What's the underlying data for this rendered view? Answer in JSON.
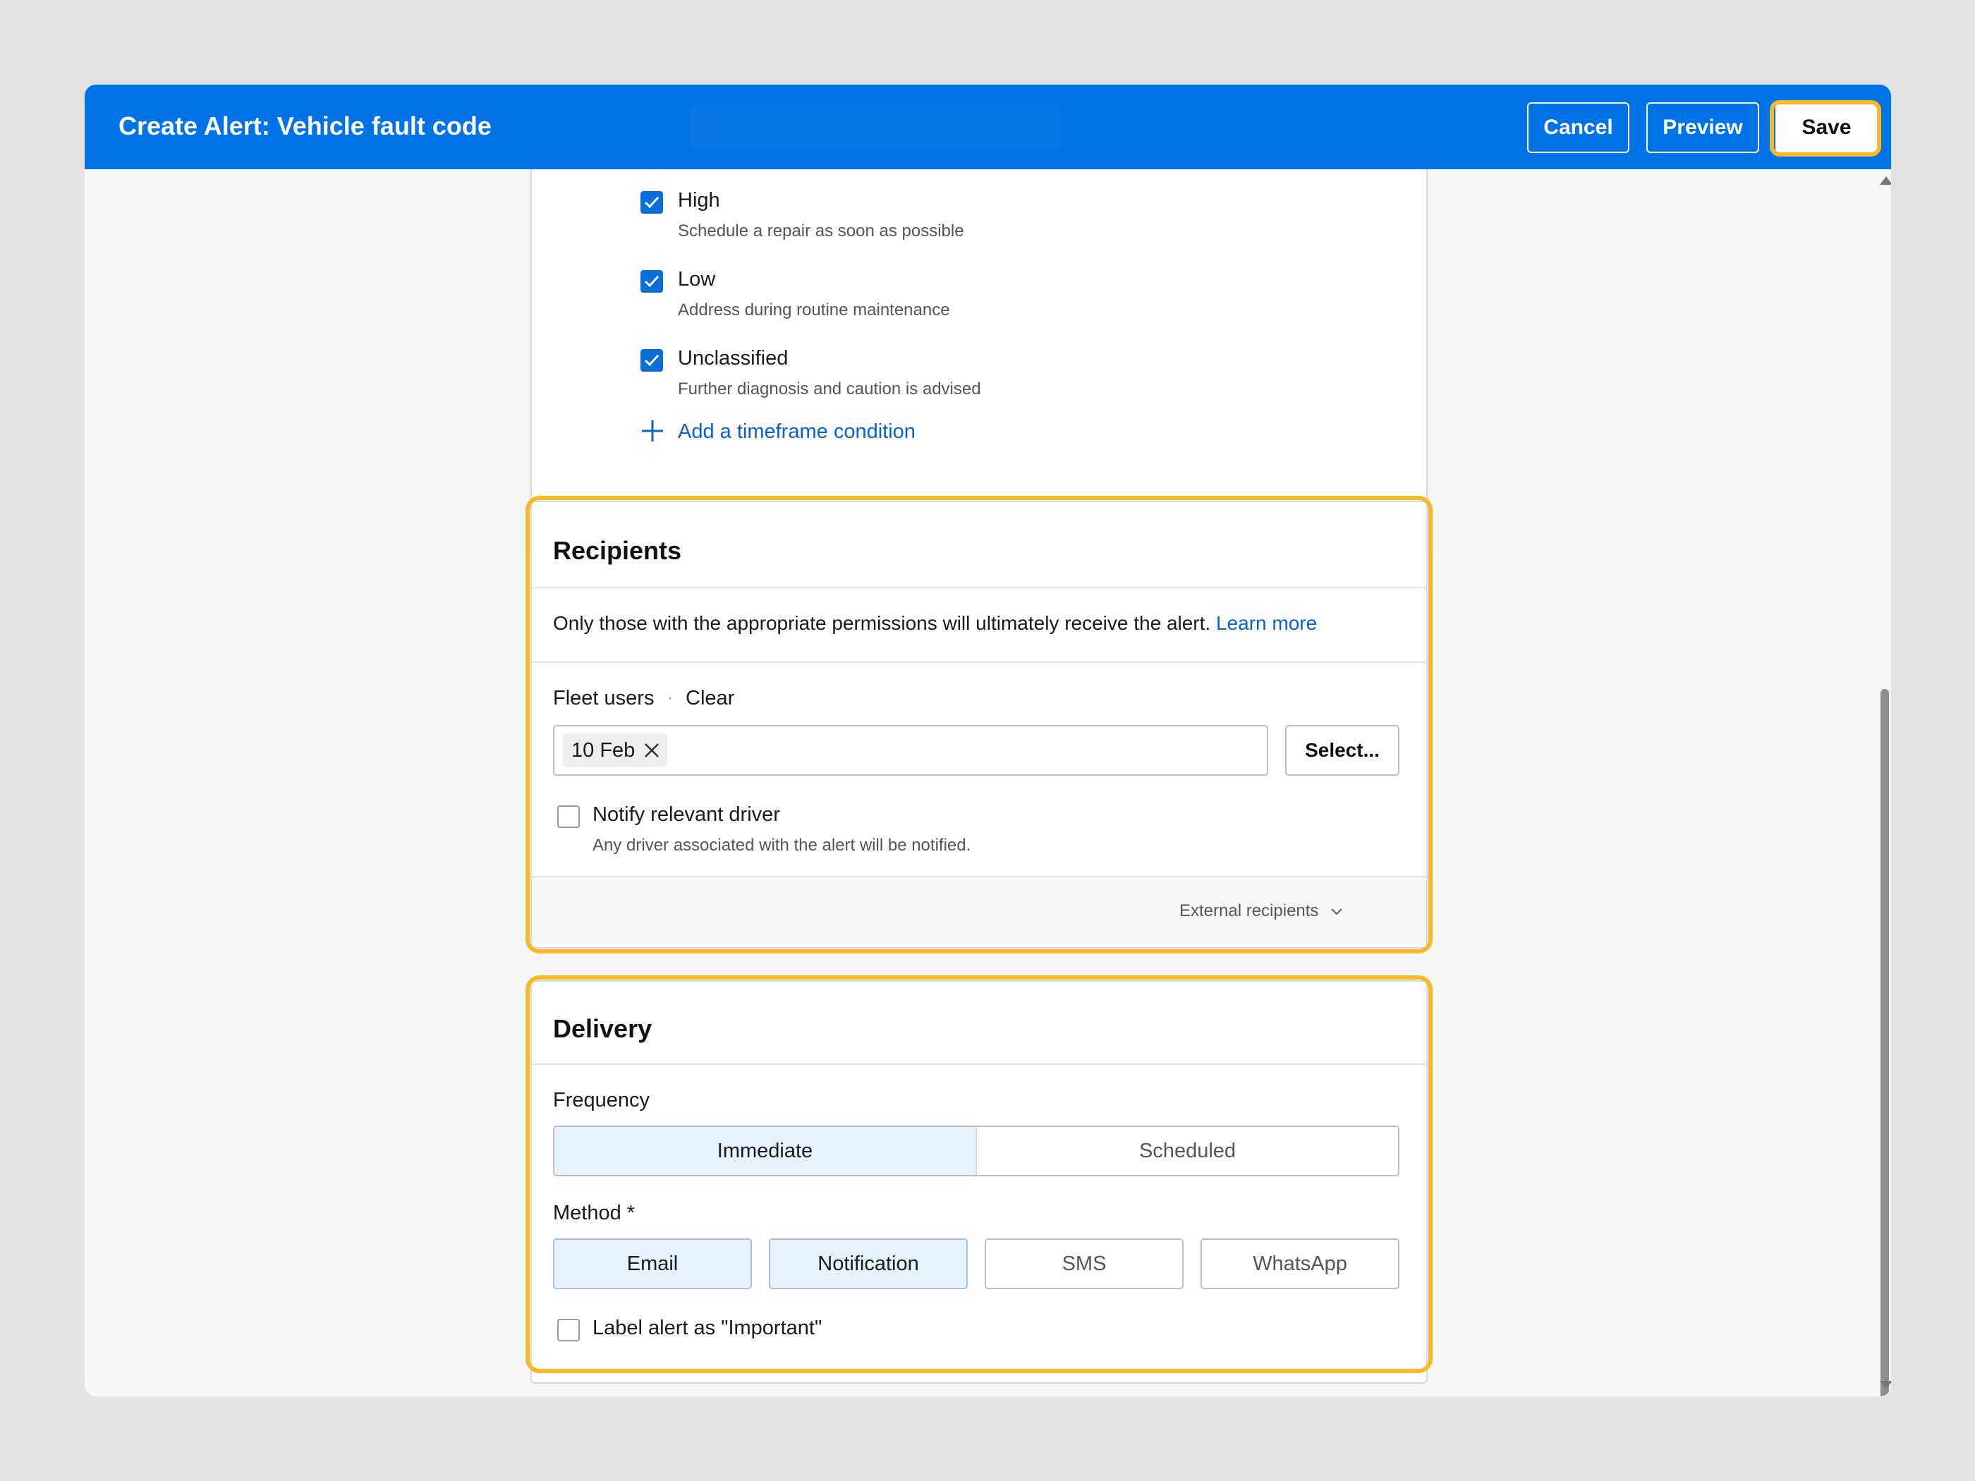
{
  "header": {
    "title": "Create Alert: Vehicle fault code",
    "cancel_label": "Cancel",
    "preview_label": "Preview",
    "save_label": "Save"
  },
  "conditions": {
    "options": [
      {
        "label": "High",
        "description": "Schedule a repair as soon as possible",
        "checked": true
      },
      {
        "label": "Low",
        "description": "Address during routine maintenance",
        "checked": true
      },
      {
        "label": "Unclassified",
        "description": "Further diagnosis and caution is advised",
        "checked": true
      }
    ],
    "add_timeframe_label": "Add a timeframe condition"
  },
  "recipients": {
    "title": "Recipients",
    "info_text": "Only those with the appropriate permissions will ultimately receive the alert.",
    "learn_more": "Learn more",
    "fleet_users_label": "Fleet users",
    "separator": "·",
    "clear_label": "Clear",
    "chip_label": "10 Feb",
    "select_label": "Select...",
    "notify_driver_label": "Notify relevant driver",
    "notify_driver_description": "Any driver associated with the alert will be notified.",
    "notify_driver_checked": false,
    "external_recipients_label": "External recipients"
  },
  "delivery": {
    "title": "Delivery",
    "frequency_label": "Frequency",
    "frequency_options": [
      "Immediate",
      "Scheduled"
    ],
    "frequency_selected": "Immediate",
    "method_label": "Method *",
    "method_options": [
      "Email",
      "Notification",
      "SMS",
      "WhatsApp"
    ],
    "method_selected": [
      "Email",
      "Notification"
    ],
    "important_label": "Label alert as \"Important\"",
    "important_checked": false
  },
  "colors": {
    "brand": "#0073e6",
    "link": "#0a62c9",
    "highlight": "#f9b924",
    "selected_fill": "#e6f3fe"
  }
}
